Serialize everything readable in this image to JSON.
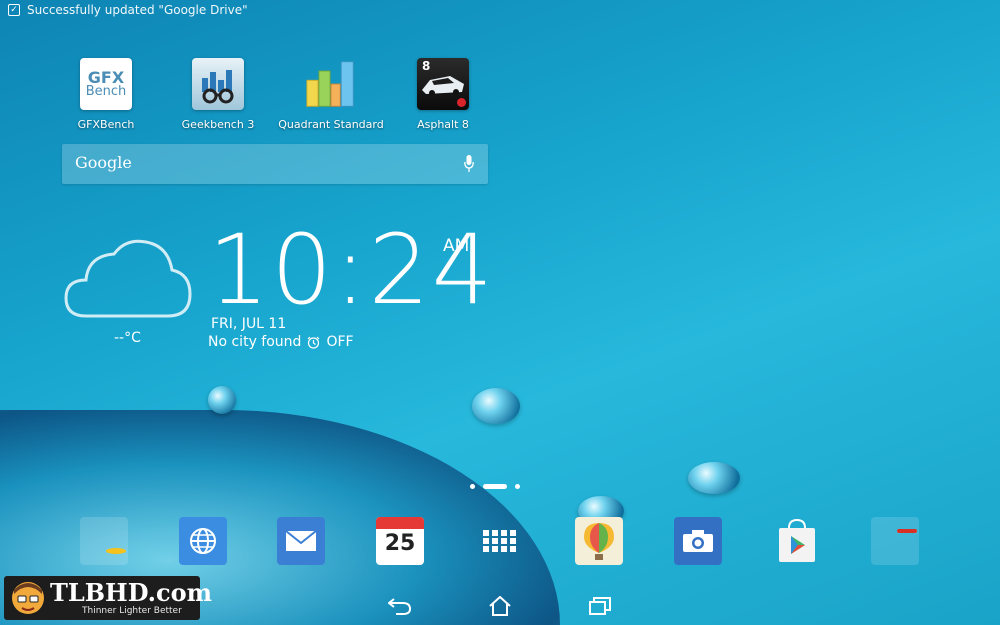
{
  "status_bar": {
    "notification_text": "Successfully updated \"Google Drive\"",
    "notification_icon": "update-check-icon"
  },
  "apps": [
    {
      "label": "GFXBench",
      "tile_text": [
        "GFX",
        "Bench"
      ],
      "icon": "gfxbench-icon"
    },
    {
      "label": "Geekbench 3",
      "icon": "geekbench-icon"
    },
    {
      "label": "Quadrant Standard",
      "icon": "quadrant-icon"
    },
    {
      "label": "Asphalt 8",
      "tile_text": [
        "8"
      ],
      "icon": "asphalt-icon"
    }
  ],
  "search": {
    "logo": "Google",
    "icon": "microphone-icon"
  },
  "weather_clock": {
    "temperature": "--°C",
    "time": "10:24",
    "ampm": "AM",
    "date": "FRI, JUL 11",
    "city": "No city found",
    "alarm": "OFF"
  },
  "dock": {
    "calendar_day": "25",
    "items": [
      "folder-icon",
      "browser-icon",
      "email-icon",
      "calendar-icon",
      "all-apps-icon",
      "gallery-icon",
      "camera-icon",
      "play-store-icon",
      "google-folder-icon"
    ]
  },
  "watermark": {
    "name": "TLBHD.com",
    "tagline": "Thinner Lighter Better"
  },
  "colors": {
    "wallpaper": "#16a3cc",
    "accent": "#ffffff"
  }
}
